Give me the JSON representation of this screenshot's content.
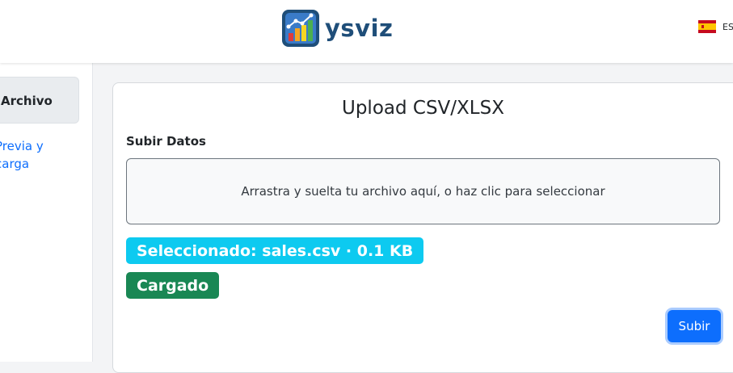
{
  "header": {
    "brand": "ysviz",
    "logo_icon": "bar-chart-logo-icon",
    "language": {
      "code": "ES",
      "flag_icon": "spain-flag-icon"
    }
  },
  "sidebar": {
    "active_item": "Archivo",
    "link_item": "Previa y\ncarga"
  },
  "card": {
    "title": "Upload CSV/XLSX",
    "section_label": "Subir Datos",
    "dropzone_text": "Arrastra y suelta tu archivo aquí, o haz clic para seleccionar",
    "selected_badge": "Seleccionado: sales.csv · 0.1 KB",
    "status_badge": "Cargado",
    "upload_button": "Subir"
  },
  "colors": {
    "primary": "#0d6efd",
    "info": "#0dcaf0",
    "success": "#198754",
    "brand": "#1f4e79"
  }
}
